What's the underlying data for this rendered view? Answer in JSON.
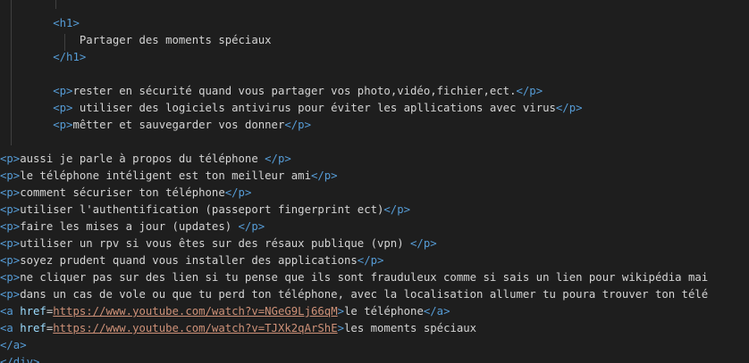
{
  "code_lines": [
    {
      "indent": "        ",
      "segments": [
        {
          "type": "tag",
          "text": "<h1>"
        }
      ]
    },
    {
      "indent": "            ",
      "segments": [
        {
          "type": "txt",
          "text": "Partager des moments spéciaux"
        }
      ]
    },
    {
      "indent": "        ",
      "segments": [
        {
          "type": "tag",
          "text": "</h1>"
        }
      ]
    },
    {
      "indent": "",
      "segments": []
    },
    {
      "indent": "        ",
      "segments": [
        {
          "type": "tag",
          "text": "<p>"
        },
        {
          "type": "txt",
          "text": "rester en sécurité quand vous partager vos photo,vidéo,fichier,ect."
        },
        {
          "type": "tag",
          "text": "</p>"
        }
      ]
    },
    {
      "indent": "        ",
      "segments": [
        {
          "type": "tag",
          "text": "<p>"
        },
        {
          "type": "txt",
          "text": " utiliser des logiciels antivirus pour éviter les apllications avec virus"
        },
        {
          "type": "tag",
          "text": "</p>"
        }
      ]
    },
    {
      "indent": "        ",
      "segments": [
        {
          "type": "tag",
          "text": "<p>"
        },
        {
          "type": "txt",
          "text": "mêtter et sauvegarder vos donner"
        },
        {
          "type": "tag",
          "text": "</p>"
        }
      ]
    },
    {
      "indent": "",
      "segments": []
    },
    {
      "indent": "",
      "segments": [
        {
          "type": "tag",
          "text": "<p>"
        },
        {
          "type": "txt",
          "text": "aussi je parle à propos du téléphone "
        },
        {
          "type": "tag",
          "text": "</p>"
        }
      ]
    },
    {
      "indent": "",
      "segments": [
        {
          "type": "tag",
          "text": "<p>"
        },
        {
          "type": "txt",
          "text": "le téléphone intéligent est ton meilleur ami"
        },
        {
          "type": "tag",
          "text": "</p>"
        }
      ]
    },
    {
      "indent": "",
      "segments": [
        {
          "type": "tag",
          "text": "<p>"
        },
        {
          "type": "txt",
          "text": "comment sécuriser ton téléphone"
        },
        {
          "type": "tag",
          "text": "</p>"
        }
      ]
    },
    {
      "indent": "",
      "segments": [
        {
          "type": "tag",
          "text": "<p>"
        },
        {
          "type": "txt",
          "text": "utiliser l'authentification (passeport fingerprint ect)"
        },
        {
          "type": "tag",
          "text": "</p>"
        }
      ]
    },
    {
      "indent": "",
      "segments": [
        {
          "type": "tag",
          "text": "<p>"
        },
        {
          "type": "txt",
          "text": "faire les mises a jour (updates) "
        },
        {
          "type": "tag",
          "text": "</p>"
        }
      ]
    },
    {
      "indent": "",
      "segments": [
        {
          "type": "tag",
          "text": "<p>"
        },
        {
          "type": "txt",
          "text": "utiliser un rpv si vous êtes sur des résaux publique (vpn) "
        },
        {
          "type": "tag",
          "text": "</p>"
        }
      ]
    },
    {
      "indent": "",
      "segments": [
        {
          "type": "tag",
          "text": "<p>"
        },
        {
          "type": "txt",
          "text": "soyez prudent quand vous installer des applications"
        },
        {
          "type": "tag",
          "text": "</p>"
        }
      ]
    },
    {
      "indent": "",
      "segments": [
        {
          "type": "tag",
          "text": "<p>"
        },
        {
          "type": "txt",
          "text": "ne cliquer pas sur des lien si tu pense que ils sont frauduleux comme si sais un lien pour wikipédia mai"
        }
      ]
    },
    {
      "indent": "",
      "segments": [
        {
          "type": "tag",
          "text": "<p>"
        },
        {
          "type": "txt",
          "text": "dans un cas de vole ou que tu perd ton téléphone, avec la localisation allumer tu poura trouver ton télé"
        }
      ]
    },
    {
      "indent": "",
      "segments": [
        {
          "type": "tag",
          "text": "<a "
        },
        {
          "type": "attr",
          "text": "href"
        },
        {
          "type": "eq",
          "text": "="
        },
        {
          "type": "url",
          "text": "https://www.youtube.com/watch?v=NGeG9Lj66qM"
        },
        {
          "type": "tag",
          "text": ">"
        },
        {
          "type": "txt",
          "text": "le téléphone"
        },
        {
          "type": "tag",
          "text": "</a>"
        }
      ]
    },
    {
      "indent": "",
      "segments": [
        {
          "type": "tag",
          "text": "<a "
        },
        {
          "type": "attr",
          "text": "href"
        },
        {
          "type": "eq",
          "text": "="
        },
        {
          "type": "url",
          "text": "https://www.youtube.com/watch?v=TJXk2qArShE"
        },
        {
          "type": "tag",
          "text": ">"
        },
        {
          "type": "txt",
          "text": "les moments spéciaux"
        }
      ]
    },
    {
      "indent": "",
      "segments": [
        {
          "type": "tag",
          "text": "</a>"
        }
      ]
    },
    {
      "indent": "",
      "segments": [
        {
          "type": "tag",
          "text": "</div>"
        }
      ]
    }
  ]
}
